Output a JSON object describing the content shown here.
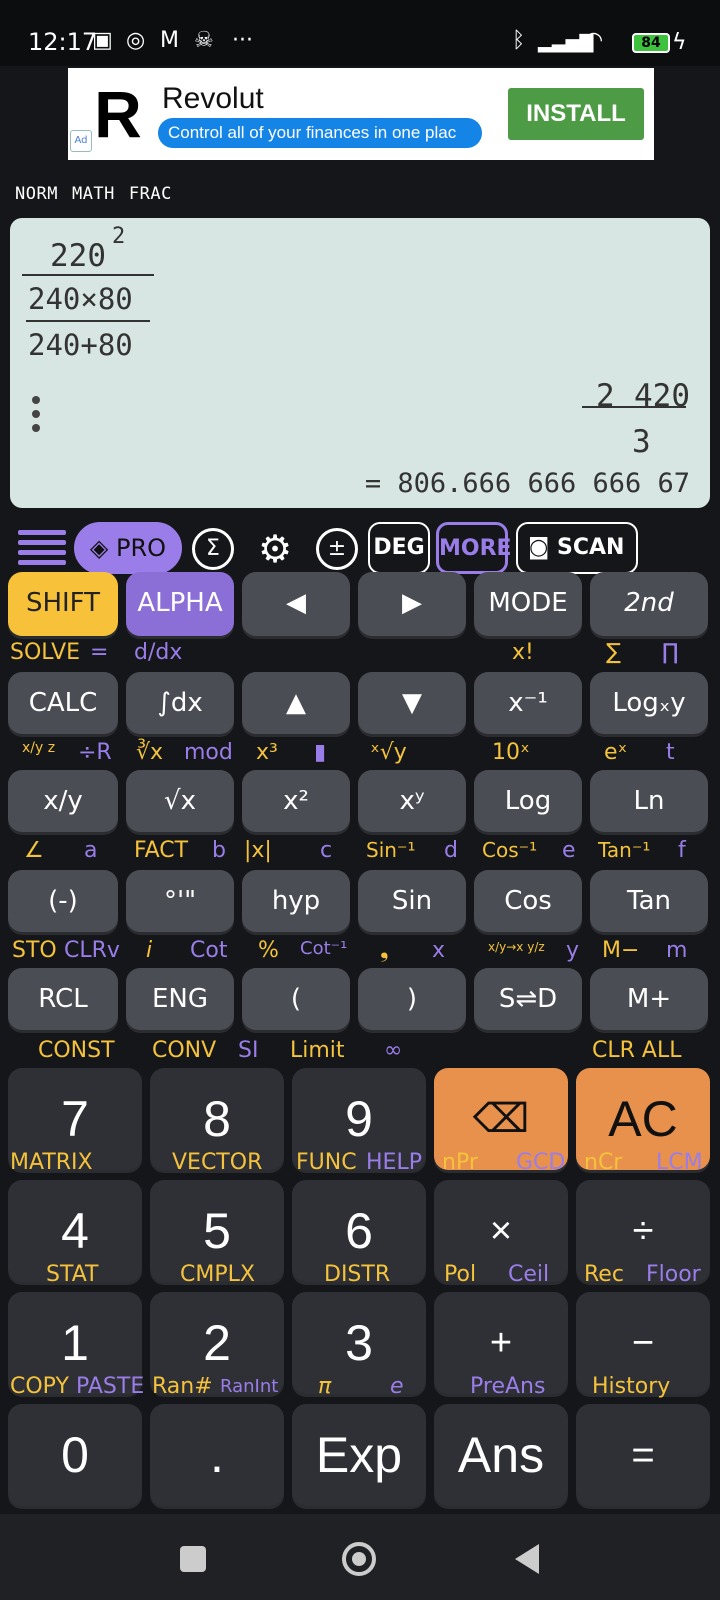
{
  "status": {
    "time": "12:17",
    "battery": "84",
    "left_icons": [
      "nfc-icon",
      "instagram-icon",
      "gmail-icon",
      "skull-icon",
      "more-icon"
    ],
    "right_icons": [
      "bluetooth-icon",
      "signal-icon",
      "wifi-icon",
      "battery-icon",
      "charging-icon"
    ]
  },
  "ad": {
    "logo": "R",
    "title": "Revolut",
    "subtitle": "Control all of your finances in one plac",
    "button": "INSTALL",
    "badge": "Ad"
  },
  "modes": [
    "NORM",
    "MATH",
    "FRAC"
  ],
  "display": {
    "numerator": "220",
    "exponent": "2",
    "den_line1": "240×80",
    "den_line2": "240+80",
    "result_whole": "2",
    "result_num": "420",
    "result_den": "3",
    "decimal": "= 806.666 666 666 67"
  },
  "toolbar": {
    "pro": "PRO",
    "sigma": "Σ",
    "gear": "⚙",
    "plusminus": "±",
    "deg": "DEG",
    "more": "MORE",
    "scan": "SCAN"
  },
  "keys": {
    "r1": [
      "SHIFT",
      "ALPHA",
      "◀",
      "▶",
      "MODE",
      "2nd"
    ],
    "r2": [
      "CALC",
      "∫dx",
      "▲",
      "▼",
      "x⁻¹",
      "Logₓy"
    ],
    "r3": [
      "x/y",
      "√x",
      "x²",
      "xʸ",
      "Log",
      "Ln"
    ],
    "r4": [
      "(-)",
      "°'\"",
      "hyp",
      "Sin",
      "Cos",
      "Tan"
    ],
    "r5": [
      "RCL",
      "ENG",
      "(",
      ")",
      "S⇌D",
      "M+"
    ],
    "r6": [
      "7",
      "8",
      "9",
      "⌫",
      "AC"
    ],
    "r7": [
      "4",
      "5",
      "6",
      "×",
      "÷"
    ],
    "r8": [
      "1",
      "2",
      "3",
      "+",
      "−"
    ],
    "r9": [
      "0",
      ".",
      "Exp",
      "Ans",
      "="
    ]
  },
  "labels": {
    "l1": {
      "solve": "SOLVE",
      "eq": "=",
      "ddx": "d/dx",
      "xfact": "x!",
      "sum": "∑",
      "prod": "∏"
    },
    "l2": {
      "xyz": "x/y z",
      "divr": "÷R",
      "cbrt": "∛x",
      "mod": "mod",
      "x3": "x³",
      "bar": "▮",
      "xroot": "ˣ√y",
      "ten": "10ˣ",
      "ex": "eˣ",
      "t": "t"
    },
    "l3": {
      "angle": "∠",
      "a": "a",
      "fact": "FACT",
      "b": "b",
      "abs": "|x|",
      "c": "c",
      "asin": "Sin⁻¹",
      "d": "d",
      "acos": "Cos⁻¹",
      "e": "e",
      "atan": "Tan⁻¹",
      "f": "f"
    },
    "l4": {
      "sto": "STO",
      "clrv": "CLRv",
      "i": "i",
      "cot": "Cot",
      "pct": "%",
      "acot": "Cot⁻¹",
      "comma": "❟",
      "x": "x",
      "conv": "x/y→x y/z",
      "y": "y",
      "mminus": "M−",
      "m": "m"
    },
    "l5": {
      "const": "CONST",
      "conv": "CONV",
      "si": "SI",
      "limit": "Limit",
      "inf": "∞",
      "clrall": "CLR ALL"
    },
    "l6": {
      "matrix": "MATRIX",
      "vector": "VECTOR",
      "func": "FUNC",
      "help": "HELP",
      "npr": "nPr",
      "gcd": "GCD",
      "ncr": "nCr",
      "lcm": "LCM"
    },
    "l7": {
      "stat": "STAT",
      "cmplx": "CMPLX",
      "distr": "DISTR",
      "pol": "Pol",
      "ceil": "Ceil",
      "rec": "Rec",
      "floor": "Floor"
    },
    "l8": {
      "copy": "COPY",
      "paste": "PASTE",
      "ran": "Ran#",
      "ranint": "RanInt",
      "pi": "π",
      "e": "e",
      "preans": "PreAns",
      "history": "History"
    }
  },
  "colors": {
    "shift": "#f7c13a",
    "alpha": "#8b6fd6",
    "orange": "#e8914d",
    "display": "#d7e6e3"
  }
}
